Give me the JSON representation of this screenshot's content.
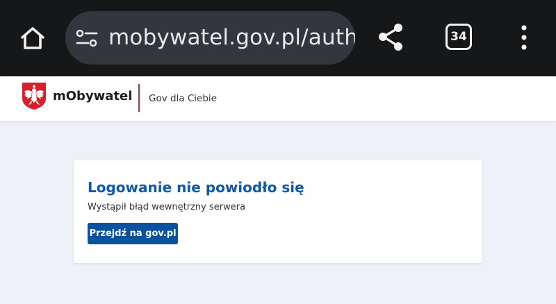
{
  "browser": {
    "url": "mobywatel.gov.pl/auth/",
    "tab_count": "34",
    "icons": {
      "home": "home-icon",
      "site_info": "tune-icon",
      "share": "share-icon",
      "tabs": "tabs-icon",
      "menu": "more-vert-icon"
    }
  },
  "header": {
    "brand": "mObywatel",
    "tagline": "Gov dla Ciebie",
    "logo": "polish-eagle-emblem"
  },
  "error_card": {
    "title": "Logowanie nie powiodło się",
    "message": "Wystąpił błąd wewnętrzny serwera",
    "button_label": "Przejdź na gov.pl"
  },
  "colors": {
    "browser_bar": "#161719",
    "url_pill": "#33373d",
    "page_bg": "#eef2f8",
    "title_blue": "#0f5aa8",
    "button_blue": "#0a52a0",
    "divider_red": "#d4213d",
    "emblem_red": "#d8202b"
  }
}
